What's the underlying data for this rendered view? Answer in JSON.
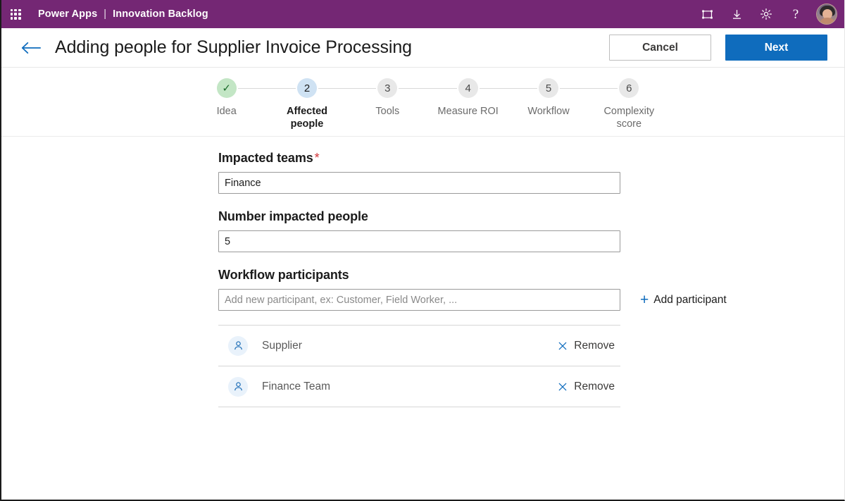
{
  "suite_bar": {
    "waffle_icon": "app-launcher-icon",
    "brand": "Power Apps",
    "separator": "|",
    "app_name": "Innovation Backlog",
    "actions": [
      {
        "name": "fit-to-screen-icon",
        "label": ""
      },
      {
        "name": "download-icon",
        "label": ""
      },
      {
        "name": "settings-gear-icon",
        "label": ""
      },
      {
        "name": "help-icon",
        "label": "?"
      }
    ],
    "avatar_alt": "user-avatar"
  },
  "title_bar": {
    "back_icon": "back-arrow-icon",
    "title": "Adding people for Supplier Invoice Processing",
    "cancel_label": "Cancel",
    "next_label": "Next"
  },
  "stepper": {
    "steps": [
      {
        "number": "1",
        "marker": "✓",
        "label": "Idea",
        "state": "done"
      },
      {
        "number": "2",
        "marker": "2",
        "label": "Affected people",
        "state": "active"
      },
      {
        "number": "3",
        "marker": "3",
        "label": "Tools",
        "state": "upcoming"
      },
      {
        "number": "4",
        "marker": "4",
        "label": "Measure ROI",
        "state": "upcoming"
      },
      {
        "number": "5",
        "marker": "5",
        "label": "Workflow",
        "state": "upcoming"
      },
      {
        "number": "6",
        "marker": "6",
        "label": "Complexity score",
        "state": "upcoming"
      }
    ]
  },
  "form": {
    "impacted_teams": {
      "label": "Impacted teams",
      "required_marker": "*",
      "value": "Finance",
      "placeholder": ""
    },
    "number_impacted_people": {
      "label": "Number impacted people",
      "value": "5",
      "placeholder": ""
    },
    "workflow_participants": {
      "label": "Workflow participants",
      "value": "",
      "placeholder": "Add new participant, ex: Customer, Field Worker, ...",
      "add_label": "Add participant",
      "add_icon": "plus-icon",
      "participants": [
        {
          "name": "Supplier",
          "remove_label": "Remove"
        },
        {
          "name": "Finance Team",
          "remove_label": "Remove"
        }
      ]
    }
  },
  "colors": {
    "suite_bar": "#742774",
    "primary_button": "#0f6cbd",
    "accent_link": "#0f6cbd",
    "required_asterisk": "#d13438",
    "step_done_bg": "#c3e6c5",
    "step_done_fg": "#1a6b2a",
    "step_active_bg": "#cfe2f3",
    "step_upcoming_bg": "#e8e8e8"
  }
}
